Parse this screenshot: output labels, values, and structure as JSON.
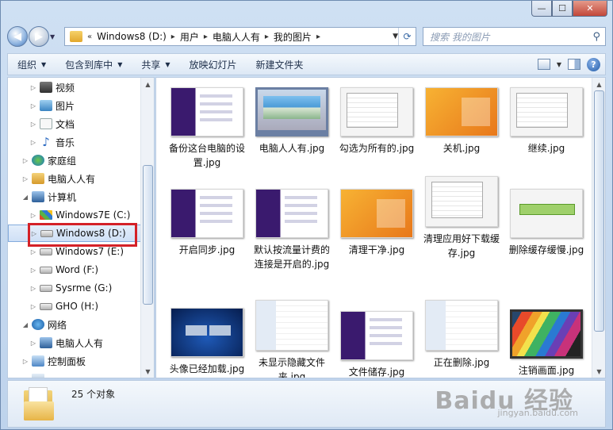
{
  "titlebar": {
    "minimize": "—",
    "maximize": "☐",
    "close": "✕"
  },
  "nav": {
    "back_glyph": "◀",
    "forward_glyph": "▶",
    "recent_glyph": "▼",
    "breadcrumb_prefix": "«",
    "breadcrumbs": [
      "Windows8 (D:)",
      "用户",
      "电脑人人有",
      "我的图片"
    ],
    "separator": "▸",
    "dropdown_glyph": "▼",
    "refresh_glyph": "⟳",
    "search_placeholder": "搜索 我的图片",
    "search_glyph": "⚲"
  },
  "toolbar": {
    "organize": "组织",
    "include_in_library": "包含到库中",
    "share": "共享",
    "slideshow": "放映幻灯片",
    "new_folder": "新建文件夹",
    "dropdown_glyph": "▼",
    "help_glyph": "?"
  },
  "sidebar": {
    "items": [
      {
        "label": "视频",
        "icon": "video-icon"
      },
      {
        "label": "图片",
        "icon": "pictures-icon"
      },
      {
        "label": "文档",
        "icon": "documents-icon"
      },
      {
        "label": "音乐",
        "icon": "music-icon",
        "glyph": "♪"
      },
      {
        "label": "家庭组",
        "icon": "homegroup-icon"
      },
      {
        "label": "电脑人人有",
        "icon": "user-folder-icon"
      },
      {
        "label": "计算机",
        "icon": "computer-icon"
      },
      {
        "label": "Windows7E (C:)",
        "icon": "drive-windows-icon"
      },
      {
        "label": "Windows8 (D:)",
        "icon": "drive-icon",
        "selected": true
      },
      {
        "label": "Windows7 (E:)",
        "icon": "drive-icon"
      },
      {
        "label": "Word (F:)",
        "icon": "drive-icon"
      },
      {
        "label": "Sysrme (G:)",
        "icon": "drive-icon"
      },
      {
        "label": "GHO (H:)",
        "icon": "drive-icon"
      },
      {
        "label": "网络",
        "icon": "network-icon"
      },
      {
        "label": "电脑人人有",
        "icon": "network-computer-icon"
      },
      {
        "label": "控制面板",
        "icon": "control-panel-icon"
      },
      {
        "label": "",
        "icon": "recycle-bin-icon"
      }
    ],
    "expand_glyph": "▷",
    "collapse_glyph": "◢"
  },
  "files": [
    {
      "label": "备份这台电脑的设置.jpg",
      "thumb": "purple-settings"
    },
    {
      "label": "电脑人人有.jpg",
      "thumb": "laptop"
    },
    {
      "label": "勾选为所有的.jpg",
      "thumb": "dialog"
    },
    {
      "label": "关机.jpg",
      "thumb": "orange-desktop"
    },
    {
      "label": "继续.jpg",
      "thumb": "dialog"
    },
    {
      "label": "开启同步.jpg",
      "thumb": "purple-settings"
    },
    {
      "label": "默认按流量计费的连接是开启的.jpg",
      "thumb": "purple-settings"
    },
    {
      "label": "清理干净.jpg",
      "thumb": "orange-desktop"
    },
    {
      "label": "清理应用好下载缓存.jpg",
      "thumb": "dialog"
    },
    {
      "label": "删除缓存缓慢.jpg",
      "thumb": "green-progress"
    },
    {
      "label": "头像已经加载.jpg",
      "thumb": "blue-screen"
    },
    {
      "label": "未显示隐藏文件夹.jpg",
      "thumb": "file-list"
    },
    {
      "label": "文件储存.jpg",
      "thumb": "purple-settings"
    },
    {
      "label": "正在删除.jpg",
      "thumb": "file-list"
    },
    {
      "label": "注销画面.jpg",
      "thumb": "rainbow"
    }
  ],
  "statusbar": {
    "count": "25 个对象"
  },
  "watermark": {
    "main": "Baidu 经验",
    "sub": "jingyan.baidu.com"
  }
}
